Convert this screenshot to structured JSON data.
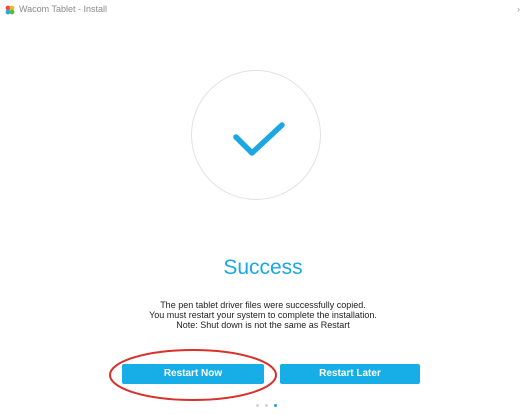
{
  "window": {
    "title": "Wacom Tablet - Install",
    "app_icon": "wacom-app-icon",
    "close_symbol": "›"
  },
  "status": {
    "icon": "checkmark-icon",
    "title": "Success",
    "message_lines": [
      "The pen tablet driver files were successfully copied.",
      "You must restart your system to complete the installation.",
      "Note: Shut down is not the same as Restart"
    ]
  },
  "actions": {
    "restart_now_label": "Restart Now",
    "restart_later_label": "Restart Later"
  },
  "pager": {
    "total": 3,
    "active_index": 2
  },
  "colors": {
    "accent": "#1ba8e2",
    "button": "#17aee8",
    "annotation": "#d9302a"
  }
}
